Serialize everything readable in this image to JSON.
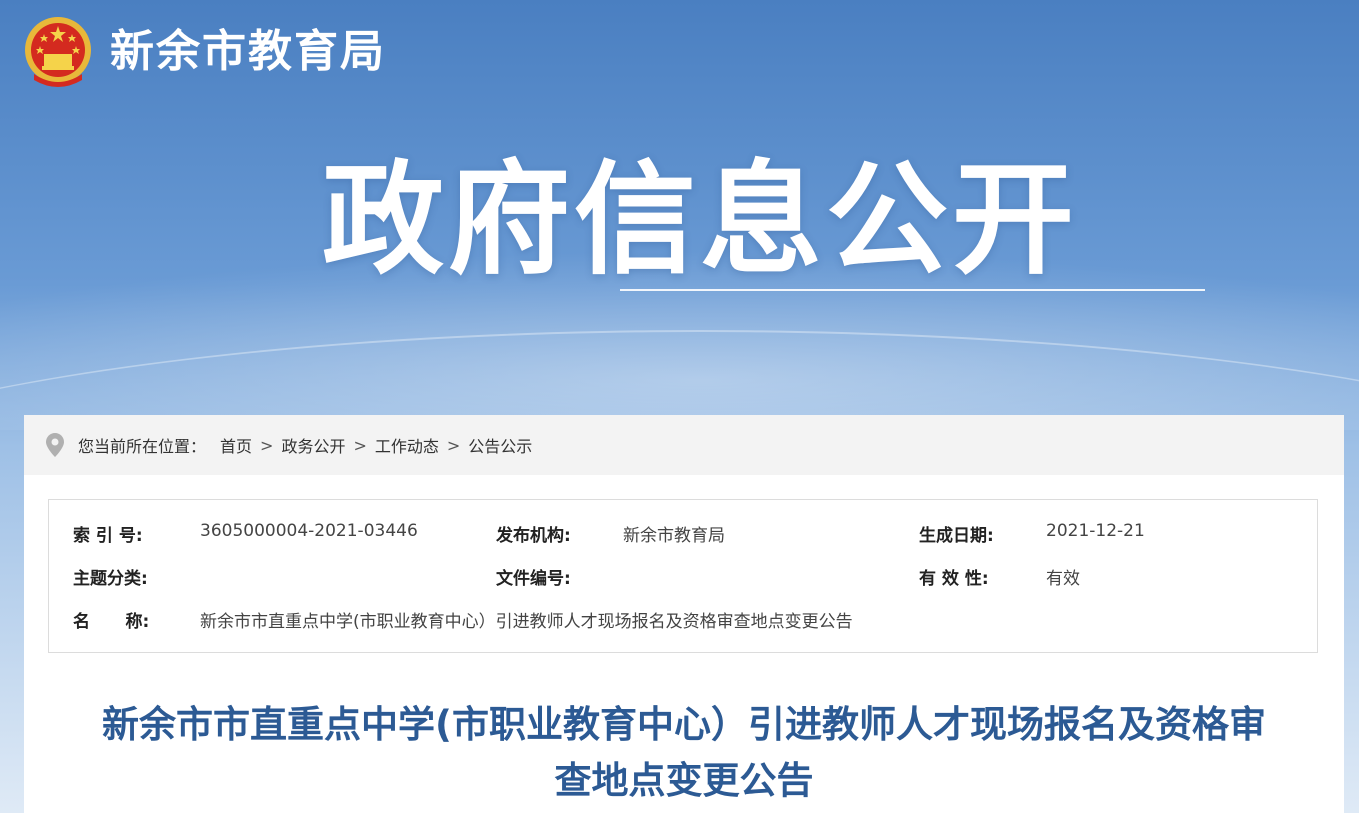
{
  "header": {
    "site_name": "新余市教育局",
    "hero_title": "政府信息公开"
  },
  "breadcrumb": {
    "prefix": "您当前所在位置：",
    "items": [
      "首页",
      "政务公开",
      "工作动态",
      "公告公示"
    ],
    "separator": ">"
  },
  "meta": {
    "index_label": "索 引 号:",
    "index_value": "3605000004-2021-03446",
    "publisher_label": "发布机构:",
    "publisher_value": "新余市教育局",
    "date_label": "生成日期:",
    "date_value": "2021-12-21",
    "topic_label": "主题分类:",
    "topic_value": "",
    "docno_label": "文件编号:",
    "docno_value": "",
    "validity_label": "有 效 性:",
    "validity_value": "有效",
    "name_label": "名      称:",
    "name_value": "新余市市直重点中学(市职业教育中心）引进教师人才现场报名及资格审查地点变更公告"
  },
  "article": {
    "title_line1": "新余市市直重点中学(市职业教育中心）引进教师人才现场报名及资格审",
    "title_line2": "查地点变更公告"
  }
}
